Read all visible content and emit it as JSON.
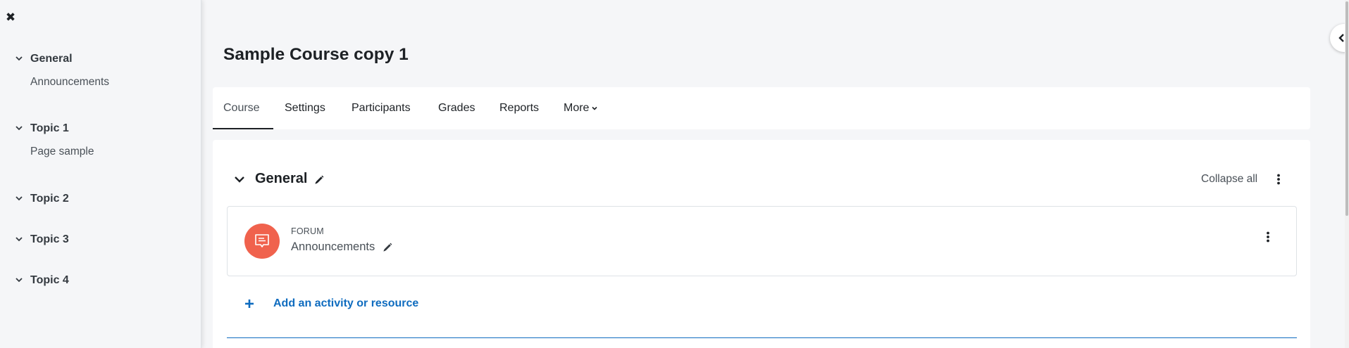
{
  "course_index": {
    "close_icon": "close-icon",
    "sections": [
      {
        "title": "General",
        "items": [
          "Announcements"
        ]
      },
      {
        "title": "Topic 1",
        "items": [
          "Page sample"
        ]
      },
      {
        "title": "Topic 2",
        "items": []
      },
      {
        "title": "Topic 3",
        "items": []
      },
      {
        "title": "Topic 4",
        "items": []
      }
    ]
  },
  "page": {
    "title": "Sample Course copy 1"
  },
  "secondary_nav": {
    "tabs": [
      {
        "label": "Course",
        "active": true
      },
      {
        "label": "Settings",
        "active": false
      },
      {
        "label": "Participants",
        "active": false
      },
      {
        "label": "Grades",
        "active": false
      },
      {
        "label": "Reports",
        "active": false
      },
      {
        "label": "More",
        "active": false,
        "dropdown": true
      }
    ]
  },
  "section": {
    "title": "General",
    "collapse_all_label": "Collapse all",
    "activities": [
      {
        "type": "FORUM",
        "name": "Announcements",
        "icon": "forum-icon",
        "icon_color": "#f0624d"
      }
    ],
    "add_activity_label": "Add an activity or resource"
  },
  "colors": {
    "accent": "#0f6cbf",
    "forum": "#f0624d",
    "text": "#1d2125"
  }
}
